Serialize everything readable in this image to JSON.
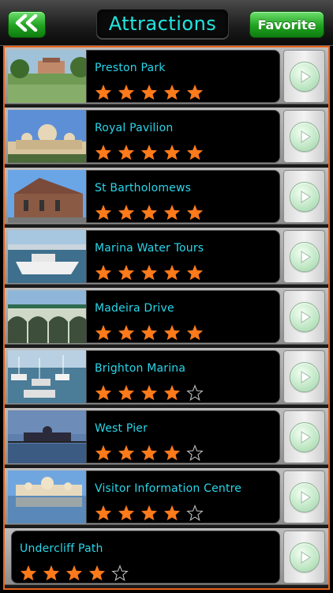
{
  "header": {
    "title": "Attractions",
    "favorite_label": "Favorite",
    "back_icon": "double-chevron-left-icon"
  },
  "colors": {
    "accent_cyan": "#22e5e0",
    "star_orange": "#ff7a1a",
    "button_green": "#1fa21f",
    "frame_orange": "#e8641d"
  },
  "attractions": [
    {
      "name": "Preston Park",
      "rating": 5,
      "has_image": true
    },
    {
      "name": "Royal Pavilion",
      "rating": 5,
      "has_image": true
    },
    {
      "name": "St Bartholomews",
      "rating": 5,
      "has_image": true
    },
    {
      "name": "Marina Water Tours",
      "rating": 5,
      "has_image": true
    },
    {
      "name": "Madeira Drive",
      "rating": 5,
      "has_image": true
    },
    {
      "name": "Brighton Marina",
      "rating": 4,
      "has_image": true
    },
    {
      "name": "West Pier",
      "rating": 4,
      "has_image": true
    },
    {
      "name": "Visitor Information Centre",
      "rating": 4,
      "has_image": true
    },
    {
      "name": "Undercliff Path",
      "rating": 4,
      "has_image": false
    }
  ],
  "max_rating": 5
}
